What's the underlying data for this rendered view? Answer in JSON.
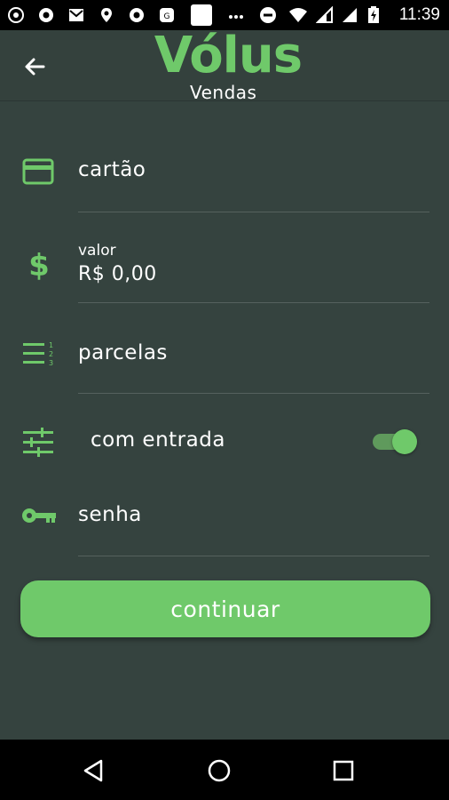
{
  "status_bar": {
    "time": "11:39",
    "icons": [
      "whatsapp-icon",
      "chrome-icon",
      "gmail-icon",
      "location-icon",
      "chrome-icon",
      "news-icon",
      "blank-app-icon",
      "more-icon",
      "do-not-disturb-icon",
      "wifi-icon",
      "signal-icon",
      "signal-icon",
      "battery-charging-icon"
    ]
  },
  "app_bar": {
    "brand": "Vólus",
    "subtitle": "Vendas"
  },
  "form": {
    "card_label": "cartão",
    "value_label": "valor",
    "value_amount": "R$ 0,00",
    "installments_label": "parcelas",
    "down_payment_label": "com entrada",
    "down_payment_enabled": true,
    "password_label": "senha"
  },
  "actions": {
    "continue_label": "continuar"
  },
  "colors": {
    "accent": "#6fc96a",
    "background": "#35433f",
    "divider": "#56615e"
  }
}
